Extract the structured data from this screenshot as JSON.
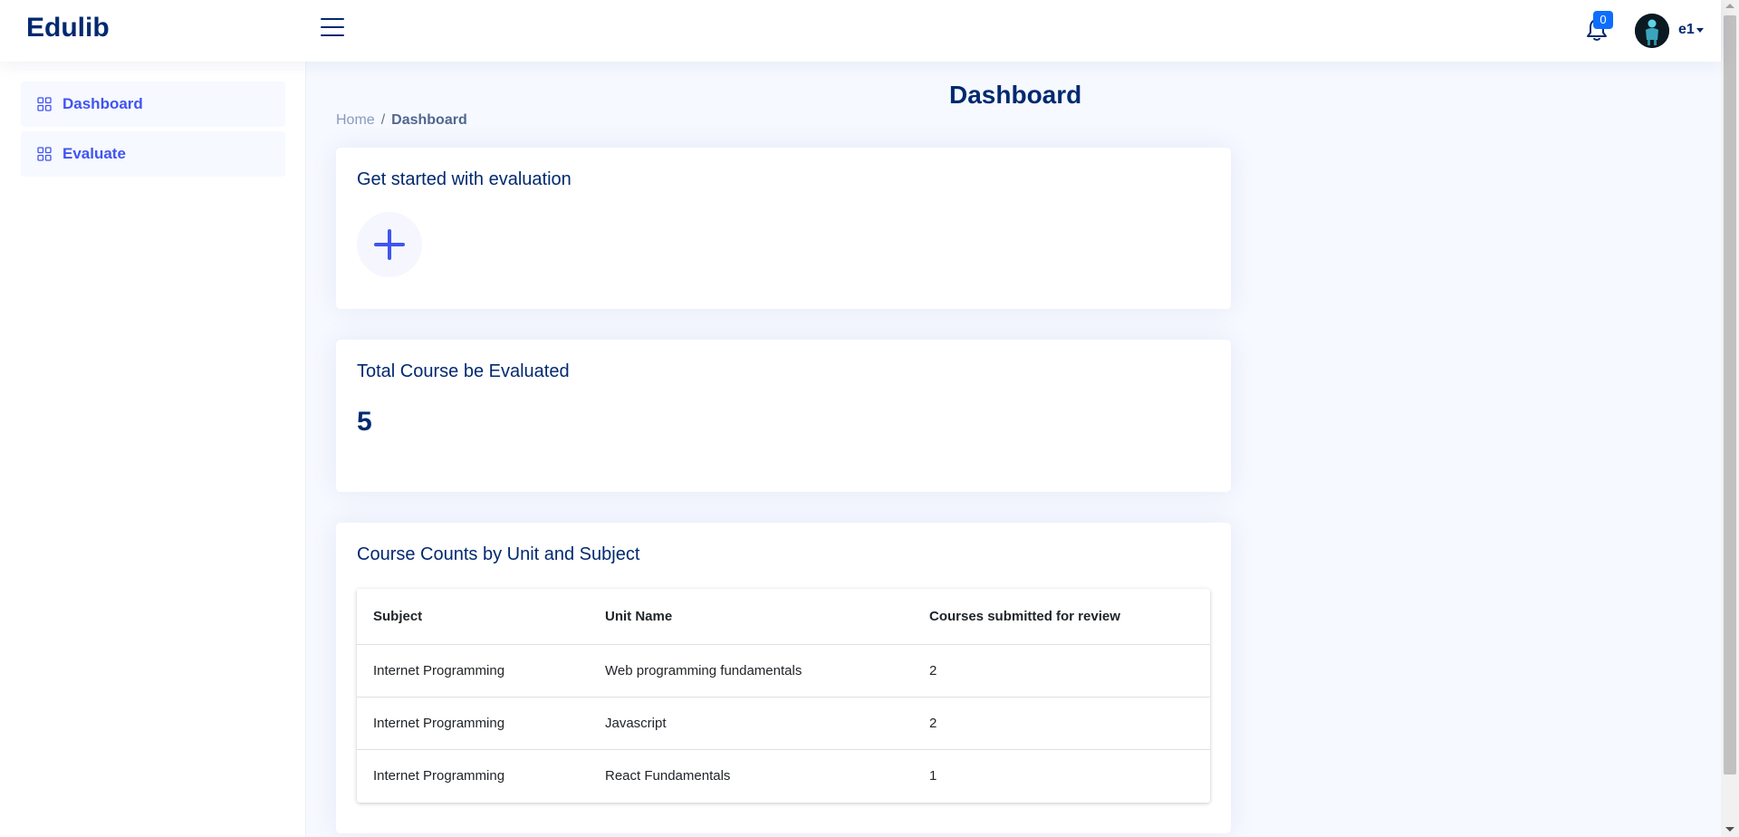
{
  "app": {
    "logo": "Edulib"
  },
  "header": {
    "notifications_count": "0",
    "user_name": "e1",
    "icons": {
      "menu": "hamburger-menu-icon",
      "notifications": "bell-icon",
      "dropdown": "caret-down-icon"
    }
  },
  "sidebar": {
    "items": [
      {
        "label": "Dashboard",
        "icon": "grid-icon"
      },
      {
        "label": "Evaluate",
        "icon": "grid-icon"
      }
    ]
  },
  "page": {
    "title": "Dashboard",
    "breadcrumb": {
      "home": "Home",
      "separator": "/",
      "current": "Dashboard"
    }
  },
  "cards": {
    "get_started": {
      "title": "Get started with evaluation",
      "add_icon": "plus-icon"
    },
    "total": {
      "title": "Total Course be Evaluated",
      "value": "5"
    },
    "course_counts": {
      "title": "Course Counts by Unit and Subject",
      "columns": [
        "Subject",
        "Unit Name",
        "Courses submitted for review"
      ],
      "rows": [
        [
          "Internet Programming",
          "Web programming fundamentals",
          "2"
        ],
        [
          "Internet Programming",
          "Javascript",
          "2"
        ],
        [
          "Internet Programming",
          "React Fundamentals",
          "1"
        ]
      ]
    }
  },
  "colors": {
    "primary": "#012970",
    "accent": "#4154f1",
    "badge": "#0d6efd",
    "background": "#f6f9ff"
  }
}
